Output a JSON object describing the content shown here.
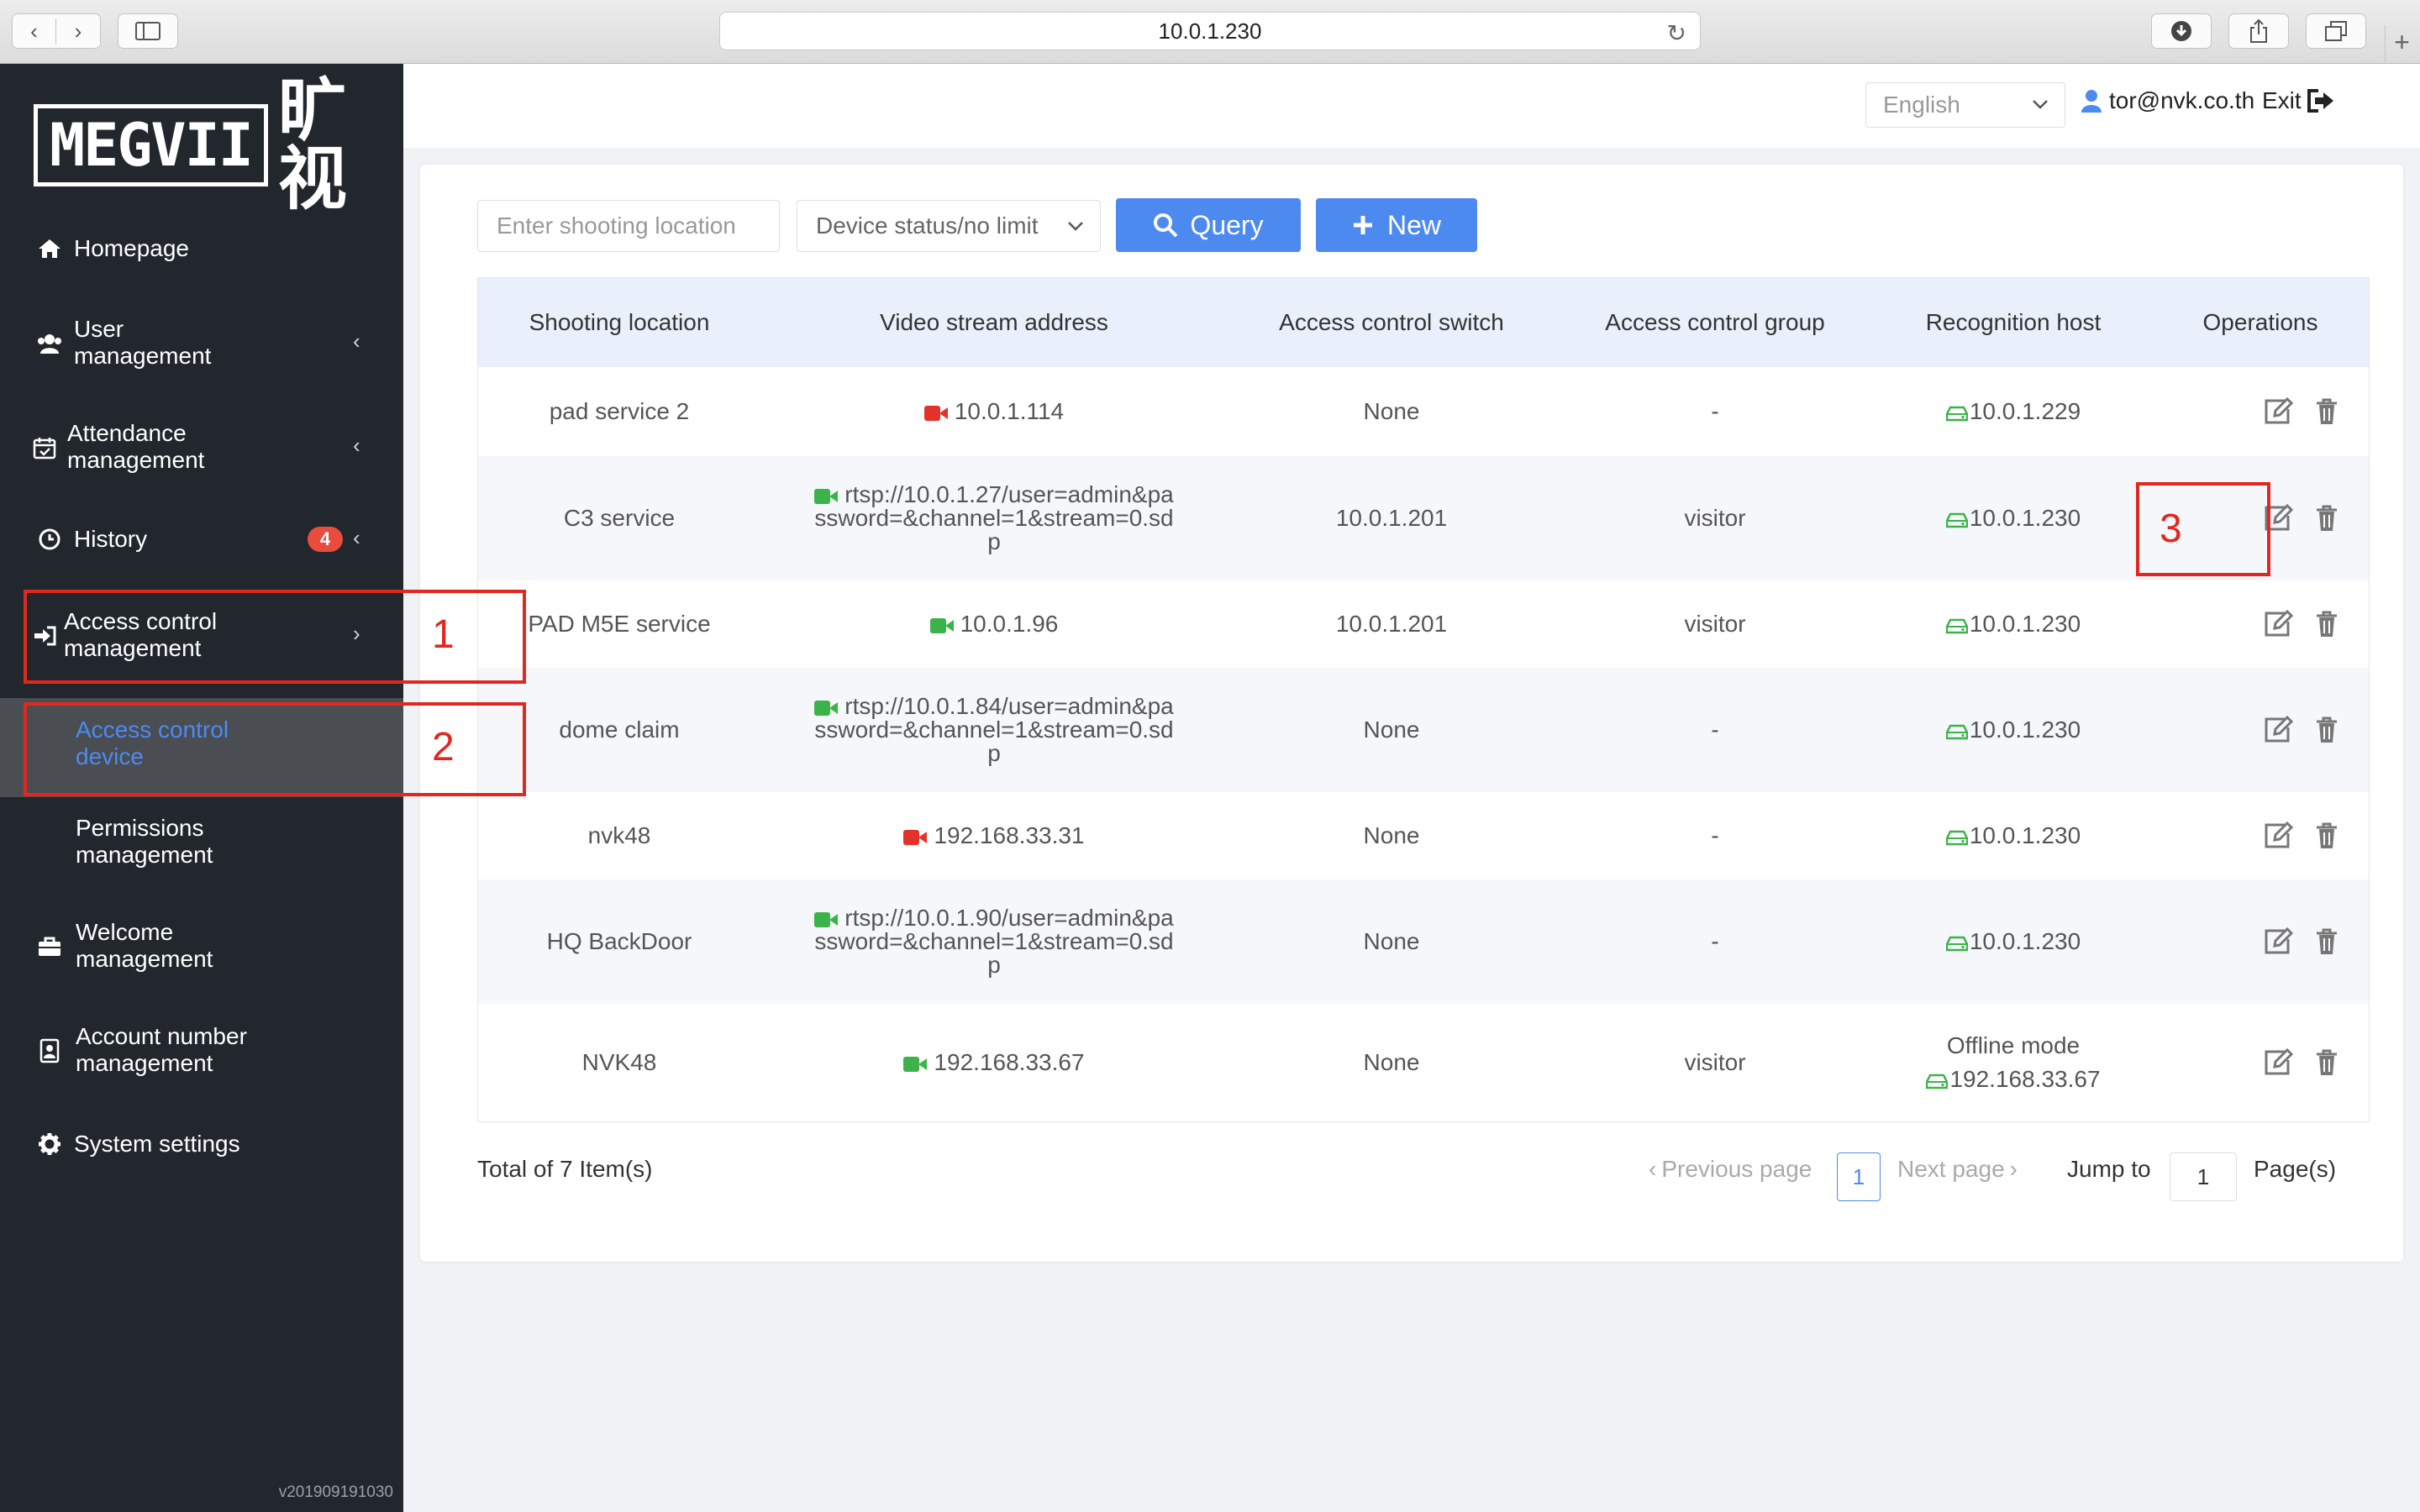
{
  "browser": {
    "url": "10.0.1.230"
  },
  "sidebar": {
    "logo_text": "MEGVII",
    "logo_cn": "旷视",
    "items": [
      {
        "label": "Homepage",
        "icon": "home-icon"
      },
      {
        "label1": "User",
        "label2": "management",
        "icon": "users-icon"
      },
      {
        "label1": "Attendance",
        "label2": "management",
        "icon": "calendar-icon"
      },
      {
        "label": "History",
        "icon": "clock-icon",
        "badge": "4"
      },
      {
        "label1": "Access control",
        "label2": "management",
        "icon": "sign-in-icon"
      },
      {
        "label1": "Access control",
        "label2": "device"
      },
      {
        "label1": "Permissions",
        "label2": "management"
      },
      {
        "label1": "Welcome",
        "label2": "management",
        "icon": "briefcase-icon"
      },
      {
        "label1": "Account number",
        "label2": "management",
        "icon": "id-card-icon"
      },
      {
        "label": "System settings",
        "icon": "gear-icon"
      }
    ],
    "version": "v201909191030"
  },
  "header": {
    "language": "English",
    "user": "tor@nvk.co.th",
    "exit": "Exit"
  },
  "filters": {
    "location_placeholder": "Enter shooting location",
    "status_select": "Device status/no limit",
    "query_label": "Query",
    "new_label": "New"
  },
  "table": {
    "columns": [
      "Shooting location",
      "Video stream address",
      "Access control switch",
      "Access control group",
      "Recognition host",
      "Operations"
    ],
    "rows": [
      {
        "location": "pad service 2",
        "stream_status": "red",
        "stream": [
          "10.0.1.114"
        ],
        "switch": "None",
        "group": "-",
        "host_note": "",
        "host": "10.0.1.229"
      },
      {
        "location": "C3 service",
        "stream_status": "green",
        "stream": [
          "rtsp://10.0.1.27/user=admin&pa",
          "ssword=&channel=1&stream=0.sd",
          "p"
        ],
        "switch": "10.0.1.201",
        "group": "visitor",
        "host_note": "",
        "host": "10.0.1.230"
      },
      {
        "location": "PAD M5E service",
        "stream_status": "green",
        "stream": [
          "10.0.1.96"
        ],
        "switch": "10.0.1.201",
        "group": "visitor",
        "host_note": "",
        "host": "10.0.1.230"
      },
      {
        "location": "dome claim",
        "stream_status": "green",
        "stream": [
          "rtsp://10.0.1.84/user=admin&pa",
          "ssword=&channel=1&stream=0.sd",
          "p"
        ],
        "switch": "None",
        "group": "-",
        "host_note": "",
        "host": "10.0.1.230"
      },
      {
        "location": "nvk48",
        "stream_status": "red",
        "stream": [
          "192.168.33.31"
        ],
        "switch": "None",
        "group": "-",
        "host_note": "",
        "host": "10.0.1.230"
      },
      {
        "location": "HQ BackDoor",
        "stream_status": "green",
        "stream": [
          "rtsp://10.0.1.90/user=admin&pa",
          "ssword=&channel=1&stream=0.sd",
          "p"
        ],
        "switch": "None",
        "group": "-",
        "host_note": "",
        "host": "10.0.1.230"
      },
      {
        "location": "NVK48",
        "stream_status": "green",
        "stream": [
          "192.168.33.67"
        ],
        "switch": "None",
        "group": "visitor",
        "host_note": "Offline mode",
        "host": "192.168.33.67"
      }
    ]
  },
  "pagination": {
    "total": "Total of 7 Item(s)",
    "prev": "Previous page",
    "current": "1",
    "next": "Next page",
    "jump_to": "Jump to",
    "jump_value": "1",
    "pages": "Page(s)"
  },
  "annotations": [
    "1",
    "2",
    "3"
  ],
  "colors": {
    "sidebar_bg": "#22272e",
    "accent": "#4d8af0",
    "active_link": "#4d8af0",
    "stream_green": "#3cb34a",
    "stream_red": "#e2332a",
    "annotation_red": "#e0281f"
  }
}
